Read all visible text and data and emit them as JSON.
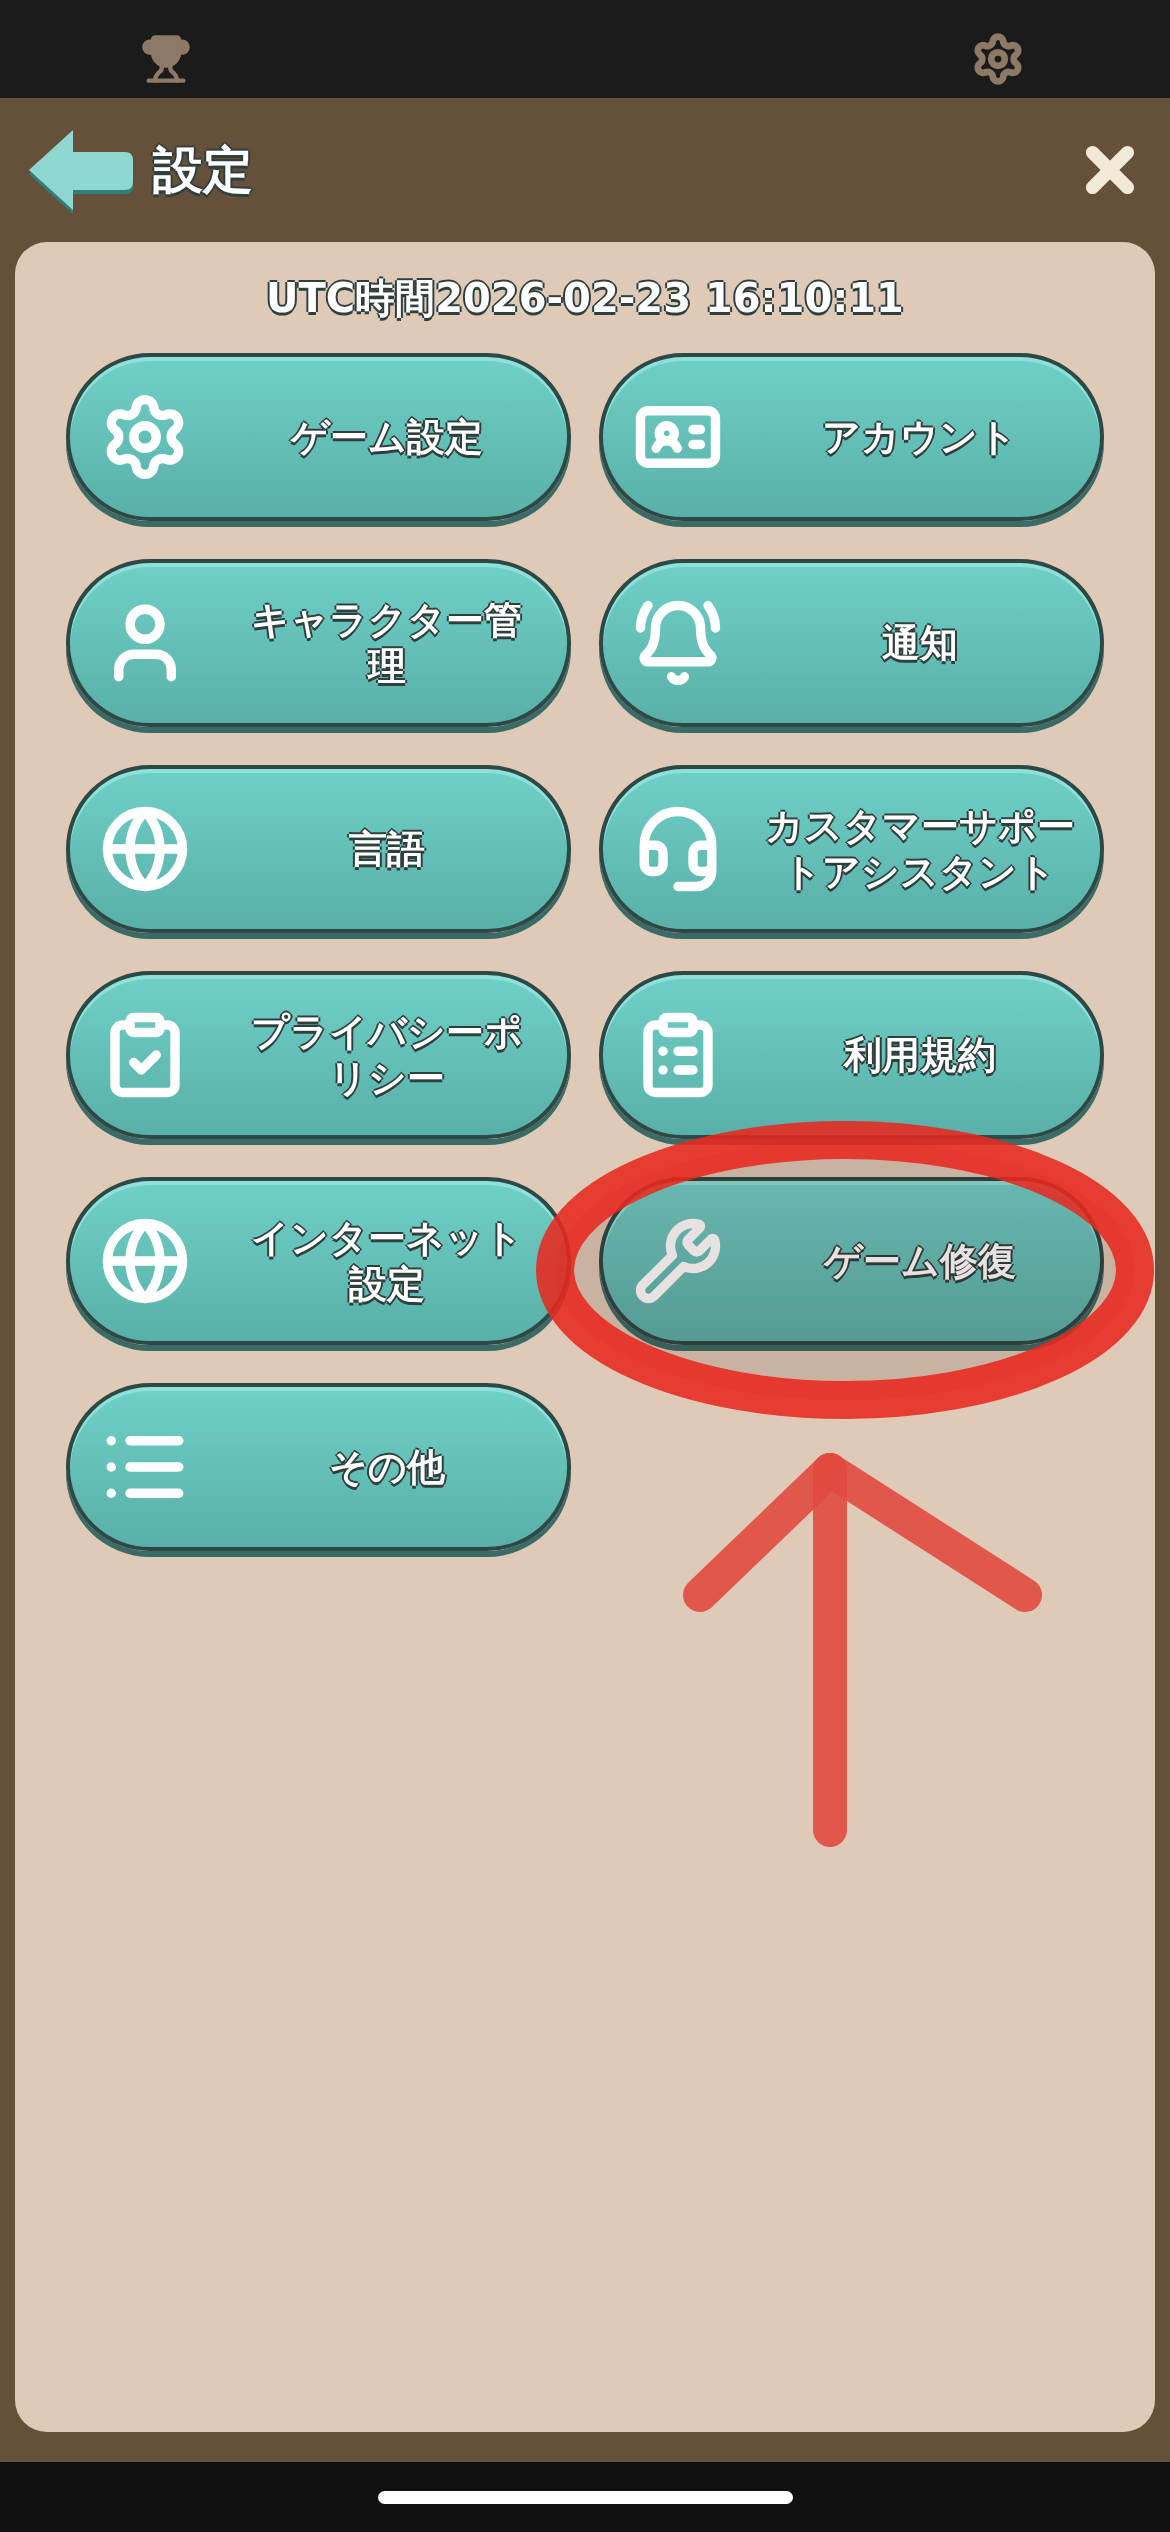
{
  "header": {
    "title": "設定"
  },
  "utc_time": "UTC時間2026-02-23 16:10:11",
  "menu": [
    {
      "label": "ゲーム設定"
    },
    {
      "label": "アカウント"
    },
    {
      "label": "キャラクター管理"
    },
    {
      "label": "通知"
    },
    {
      "label": "言語"
    },
    {
      "label": "カスタマーサポートアシスタント"
    },
    {
      "label": "プライバシーポリシー"
    },
    {
      "label": "利用規約"
    },
    {
      "label": "インターネット設定"
    },
    {
      "label": "ゲーム修復"
    },
    {
      "label": "その他"
    }
  ]
}
